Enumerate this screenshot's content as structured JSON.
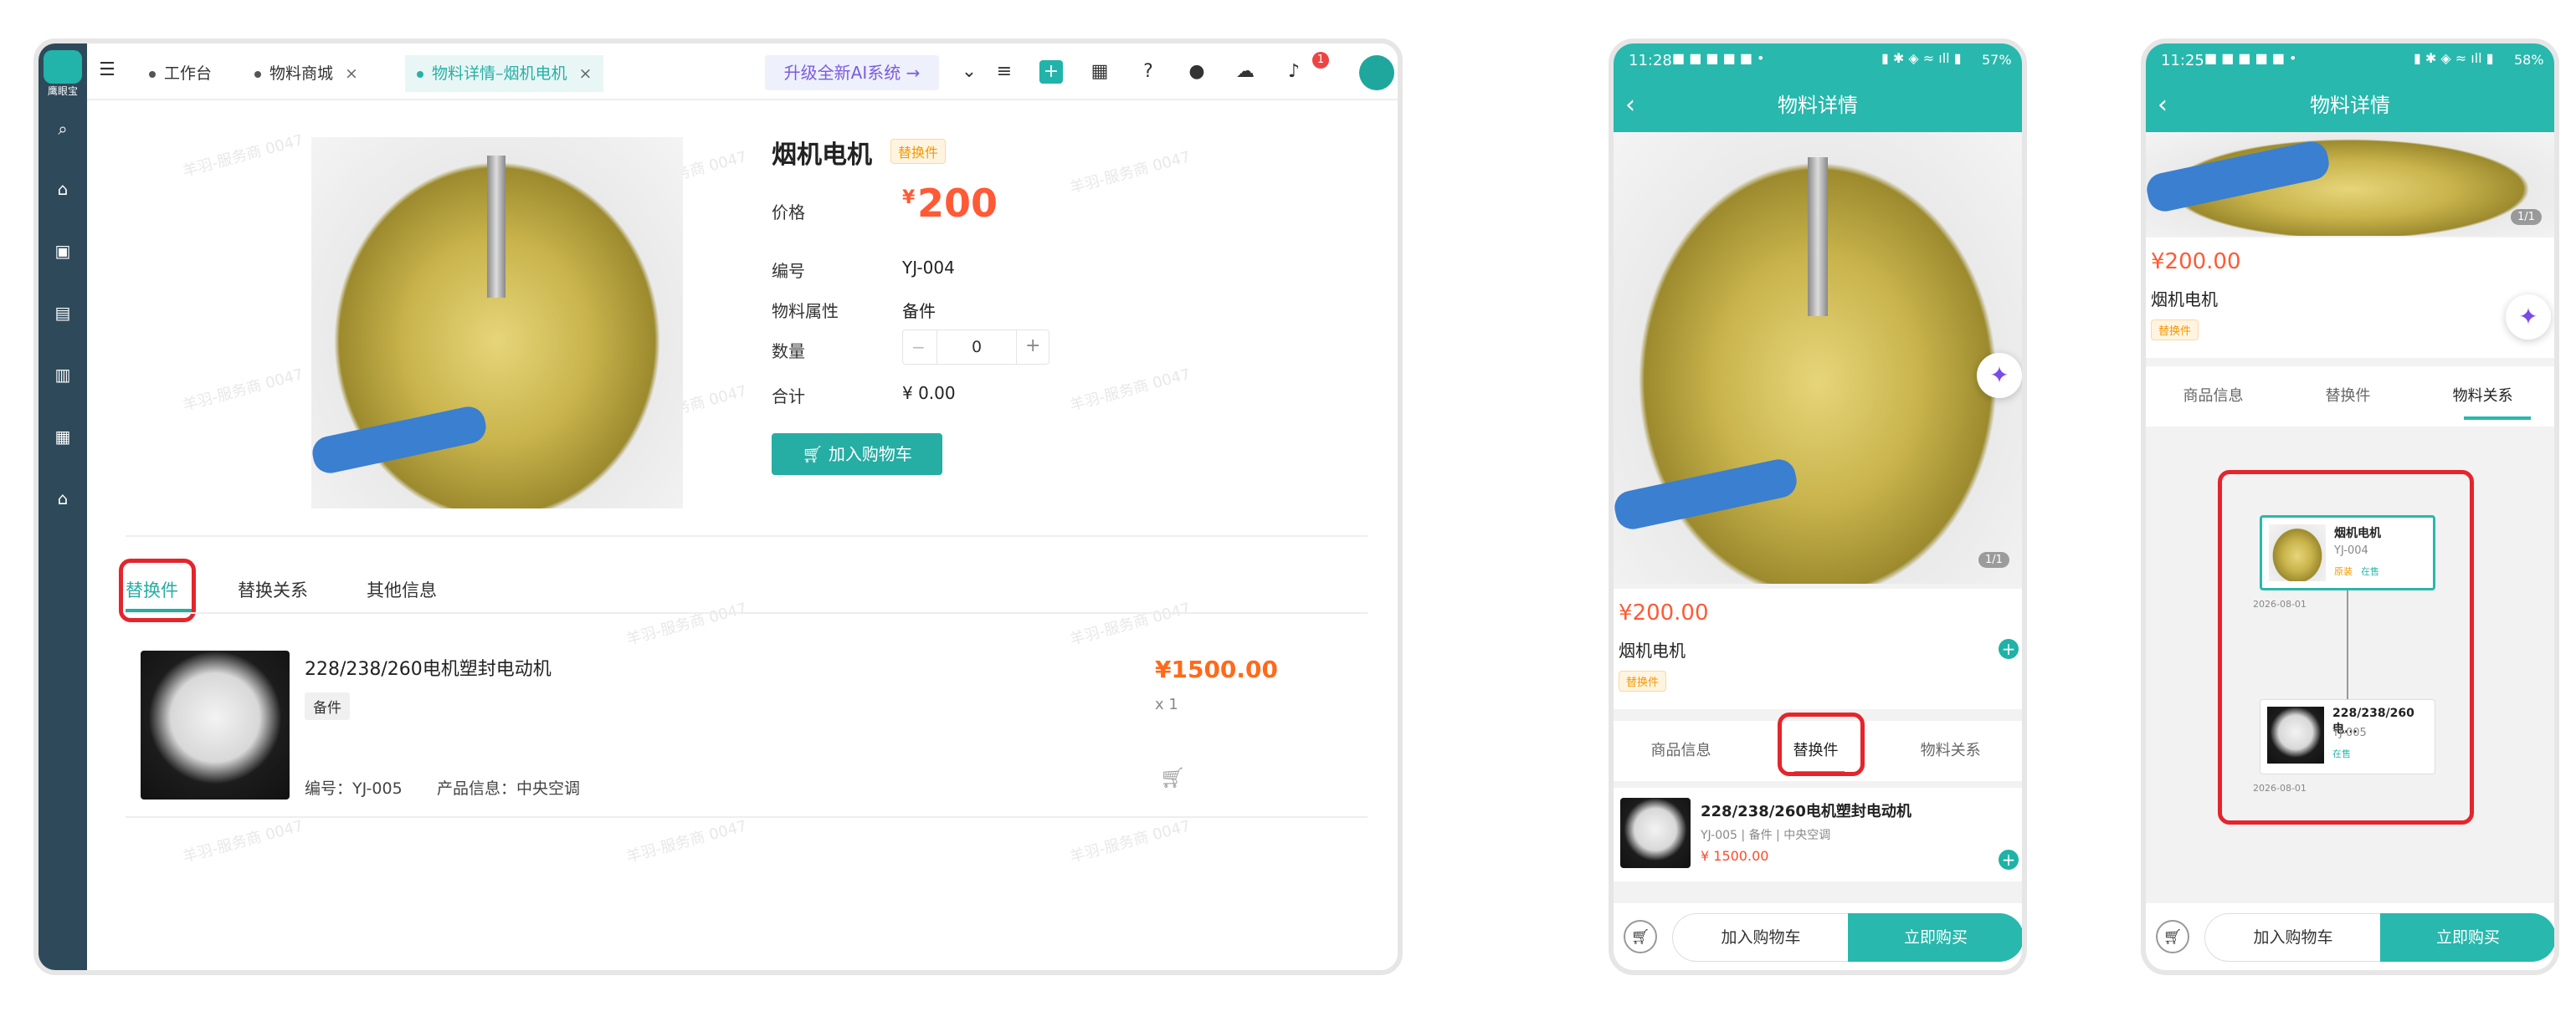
{
  "desktop": {
    "sidebar": {
      "logo_text": "鹰眼宝",
      "icons": [
        "search-icon",
        "home-icon",
        "save-icon",
        "badge-icon",
        "bag-icon",
        "archive-icon",
        "store-icon"
      ]
    },
    "tabs": [
      {
        "label": "工作台",
        "closable": false
      },
      {
        "label": "物料商城",
        "closable": true
      },
      {
        "label": "物料详情–烟机电机",
        "closable": true,
        "active": true
      }
    ],
    "ai_button": "升级全新AI系统 →",
    "notification_count": "1",
    "product": {
      "title": "烟机电机",
      "tag": "替换件",
      "price_label": "价格",
      "price_symbol": "¥",
      "price_value": "200",
      "code_label": "编号",
      "code_value": "YJ-004",
      "attr_label": "物料属性",
      "attr_value": "备件",
      "qty_label": "数量",
      "qty_value": "0",
      "total_label": "合计",
      "total_value": "¥ 0.00",
      "cart_button": "加入购物车"
    },
    "content_tabs": [
      "替换件",
      "替换关系",
      "其他信息"
    ],
    "replacement": {
      "title": "228/238/260电机塑封电动机",
      "chip": "备件",
      "code": "编号：YJ-005",
      "info": "产品信息：中央空调",
      "price": "¥1500.00",
      "qty": "x 1"
    },
    "watermark": "羊羽-服务商 0047"
  },
  "phone1": {
    "time": "11:28",
    "battery": "57%",
    "title": "物料详情",
    "image_counter": "1/1",
    "price": "¥200.00",
    "name": "烟机电机",
    "tag": "替换件",
    "tabs": [
      "商品信息",
      "替换件",
      "物料关系"
    ],
    "item": {
      "title": "228/238/260电机塑封电动机",
      "sub": "YJ-005 | 备件 | 中央空调",
      "price": "¥ 1500.00"
    },
    "add_cart": "加入购物车",
    "buy_now": "立即购买"
  },
  "phone2": {
    "time": "11:25",
    "battery": "58%",
    "title": "物料详情",
    "image_counter": "1/1",
    "price": "¥200.00",
    "name": "烟机电机",
    "tag": "替换件",
    "tabs": [
      "商品信息",
      "替换件",
      "物料关系"
    ],
    "node1": {
      "title": "烟机电机",
      "code": "YJ-004",
      "tag1": "原装",
      "tag2": "在售",
      "date": "2026-08-01"
    },
    "node2": {
      "title": "228/238/260电...",
      "code": "YJ-005",
      "tag1": "在售",
      "date": "2026-08-01"
    },
    "add_cart": "加入购物车",
    "buy_now": "立即购买"
  },
  "colors": {
    "teal": "#28b8ad",
    "price_red": "#ff5a35",
    "highlight_red": "#e5242b",
    "sidebar": "#2e4a5a"
  }
}
